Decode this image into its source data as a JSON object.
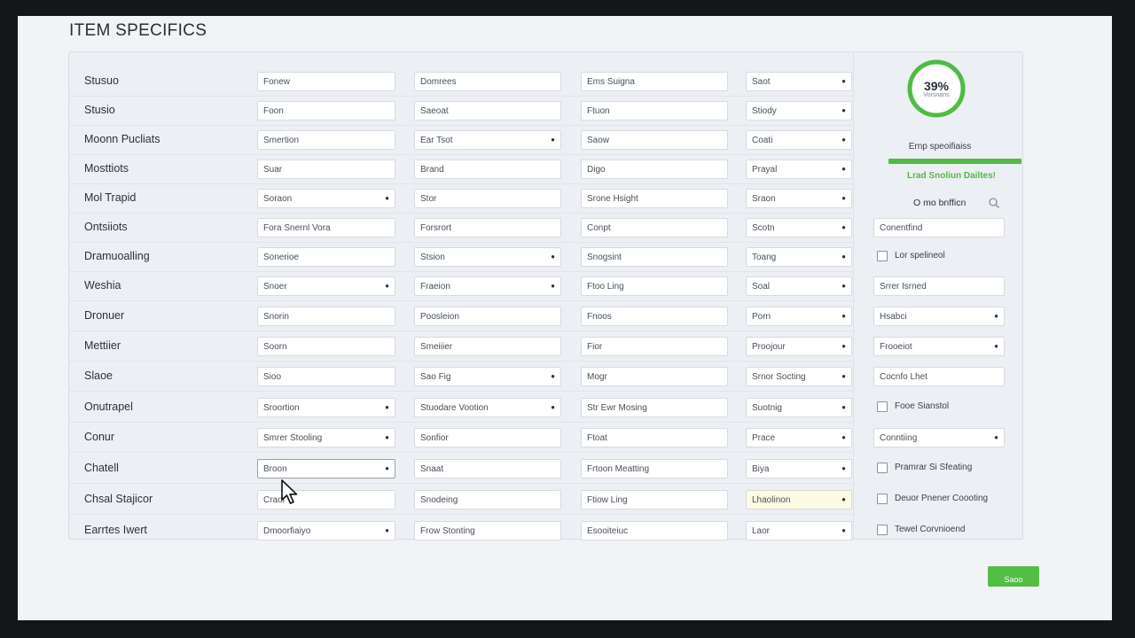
{
  "page_title": "ITEM SPECIFICS",
  "rows": [
    {
      "label": "Stusuo",
      "cells": [
        {
          "text": "Fonew"
        },
        {
          "text": "Domrees"
        },
        {
          "text": "Ems Suigna"
        },
        {
          "text": "Saot",
          "dropdown": true
        }
      ]
    },
    {
      "label": "Stusio",
      "cells": [
        {
          "text": "Foon"
        },
        {
          "text": "Saeoat"
        },
        {
          "text": "Ftuon"
        },
        {
          "text": "Stiody",
          "dropdown": true
        }
      ]
    },
    {
      "label": "Moonn Pucliats",
      "cells": [
        {
          "text": "Smertion"
        },
        {
          "text": "Ear Tsot",
          "dropdown": true
        },
        {
          "text": "Saow"
        },
        {
          "text": "Coati",
          "dropdown": true
        }
      ]
    },
    {
      "label": "Mosttiots",
      "cells": [
        {
          "text": "Suar"
        },
        {
          "text": "Brand"
        },
        {
          "text": "Digo"
        },
        {
          "text": "Prayal",
          "dropdown": true
        }
      ]
    },
    {
      "label": "Mol Trapid",
      "cells": [
        {
          "text": "Soraon",
          "dropdown": true
        },
        {
          "text": "Stor"
        },
        {
          "text": "Srone Hsight"
        },
        {
          "text": "Sraon",
          "dropdown": true
        }
      ]
    },
    {
      "label": "Ontsiiots",
      "cells": [
        {
          "text": "Fora Snernl Vora"
        },
        {
          "text": "Forsrort"
        },
        {
          "text": "Conpt"
        },
        {
          "text": "Scotn",
          "dropdown": true
        }
      ]
    },
    {
      "label": "Dramuoalling",
      "cells": [
        {
          "text": "Sonerioe"
        },
        {
          "text": "Stsion",
          "dropdown": true
        },
        {
          "text": "Snogsint"
        },
        {
          "text": "Toang",
          "dropdown": true
        }
      ]
    },
    {
      "label": "Weshia",
      "cells": [
        {
          "text": "Snoer",
          "dropdown": true
        },
        {
          "text": "Fraeion",
          "dropdown": true
        },
        {
          "text": "Ftoo Ling"
        },
        {
          "text": "Soal",
          "dropdown": true
        }
      ]
    },
    {
      "label": "Dronuer",
      "cells": [
        {
          "text": "Snorin"
        },
        {
          "text": "Poosleion"
        },
        {
          "text": "Fnoos"
        },
        {
          "text": "Porn",
          "dropdown": true
        }
      ]
    },
    {
      "label": "Mettiier",
      "cells": [
        {
          "text": "Soorn"
        },
        {
          "text": "Smeiiier"
        },
        {
          "text": "Fior"
        },
        {
          "text": "Proojour",
          "dropdown": true
        }
      ]
    },
    {
      "label": "Slaoe",
      "cells": [
        {
          "text": "Sioo"
        },
        {
          "text": "Sao Fig",
          "dropdown": true
        },
        {
          "text": "Mogr"
        },
        {
          "text": "Srnor Socting",
          "dropdown": true
        }
      ]
    },
    {
      "label": "Onutrapel",
      "cells": [
        {
          "text": "Sroortion",
          "dropdown": true
        },
        {
          "text": "Stuodare Vootion",
          "dropdown": true
        },
        {
          "text": "Str Ewr Mosing"
        },
        {
          "text": "Suotnig",
          "dropdown": true
        }
      ]
    },
    {
      "label": "Conur",
      "cells": [
        {
          "text": "Smrer Stooling",
          "dropdown": true
        },
        {
          "text": "Sonfior"
        },
        {
          "text": "Ftoat"
        },
        {
          "text": "Prace",
          "dropdown": true
        }
      ]
    },
    {
      "label": "Chatell",
      "cells": [
        {
          "text": "Broon",
          "dropdown": true,
          "active": true
        },
        {
          "text": "Snaat"
        },
        {
          "text": "Frtoon Meatting"
        },
        {
          "text": "Biya",
          "dropdown": true
        }
      ]
    },
    {
      "label": "Chsal Stajicor",
      "cells": [
        {
          "text": "Craor"
        },
        {
          "text": "Snodeing"
        },
        {
          "text": "Ftiow Ling"
        },
        {
          "text": "Lhaolinon",
          "dropdown": true,
          "highlight": true
        }
      ]
    },
    {
      "label": "Earrtes Iwert",
      "cells": [
        {
          "text": "Dmoorfiaiyo",
          "dropdown": true
        },
        {
          "text": "Frow Stonting"
        },
        {
          "text": "Esooiteiuc"
        },
        {
          "text": "Laor",
          "dropdown": true
        }
      ]
    }
  ],
  "sidebar": {
    "progress_percent": 39,
    "progress_text": "39%",
    "progress_subtext": "Vorsnans",
    "caption": "Ernp speoifiaiss",
    "bar_fill_percent": 100,
    "status": "Lrad Snoliun Dailtes!",
    "search_label": "O mo bnfficn",
    "items": [
      {
        "type": "text",
        "text": "Conentfind"
      },
      {
        "type": "check",
        "text": "Lor spelineol"
      },
      {
        "type": "text",
        "text": "Srrer Isrned"
      },
      {
        "type": "select",
        "text": "Hsabci"
      },
      {
        "type": "select",
        "text": "Frooeiot"
      },
      {
        "type": "text",
        "text": "Cocnfo Lhet"
      },
      {
        "type": "check",
        "text": "Fooe Sianstol"
      },
      {
        "type": "select",
        "text": "Conntiing"
      },
      {
        "type": "check",
        "text": "Pramrar Si Sfeating"
      },
      {
        "type": "check",
        "text": "Deuor Pnener Coooting"
      },
      {
        "type": "check",
        "text": "Tewel Corvnioend"
      }
    ]
  },
  "save_label": "Saoo",
  "colors": {
    "accent": "#54bd45",
    "background": "#f1f3f6",
    "highlight_field": "#fdfbe3"
  }
}
